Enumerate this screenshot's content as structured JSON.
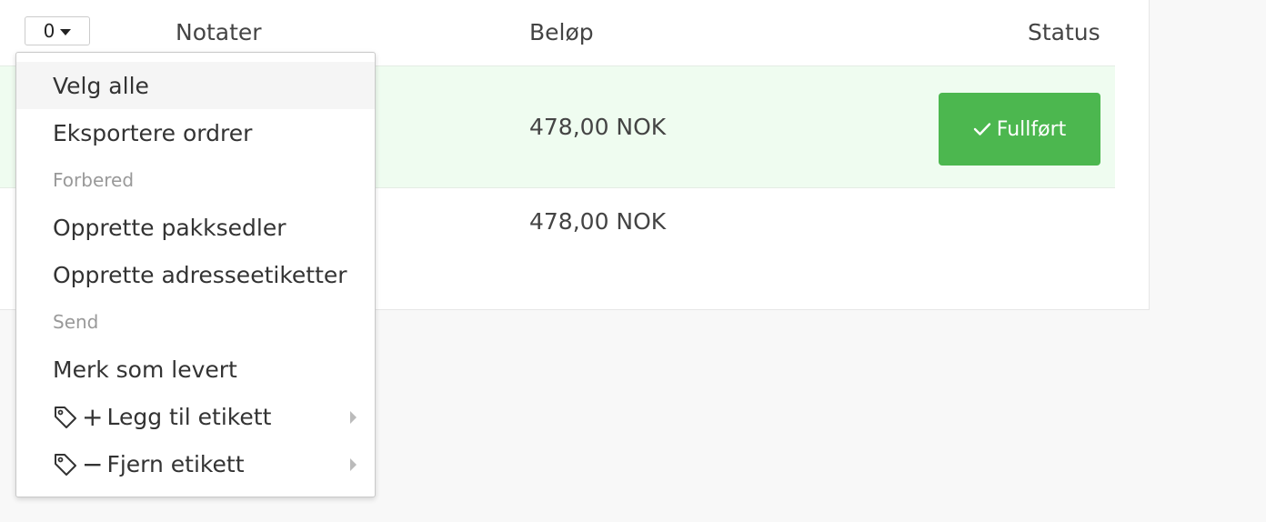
{
  "table": {
    "select_count": "0",
    "columns": {
      "notes": "Notater",
      "amount": "Beløp",
      "status": "Status"
    },
    "rows": [
      {
        "amount": "478,00 NOK",
        "status": "Fullført"
      },
      {
        "amount": "478,00 NOK",
        "status": ""
      }
    ]
  },
  "dropdown": {
    "items": [
      {
        "label": "Velg alle"
      },
      {
        "label": "Eksportere ordrer"
      },
      {
        "header": "Forbered"
      },
      {
        "label": "Opprette pakksedler"
      },
      {
        "label": "Opprette adresseetiketter"
      },
      {
        "header": "Send"
      },
      {
        "label": "Merk som levert"
      },
      {
        "label": "Legg til etikett",
        "prefix": "+",
        "icon": "tag-icon",
        "submenu": true
      },
      {
        "label": "Fjern etikett",
        "prefix": "−",
        "icon": "tag-icon",
        "submenu": true
      }
    ]
  },
  "colors": {
    "success": "#4cb74f",
    "row_highlight": "#effcf0"
  }
}
